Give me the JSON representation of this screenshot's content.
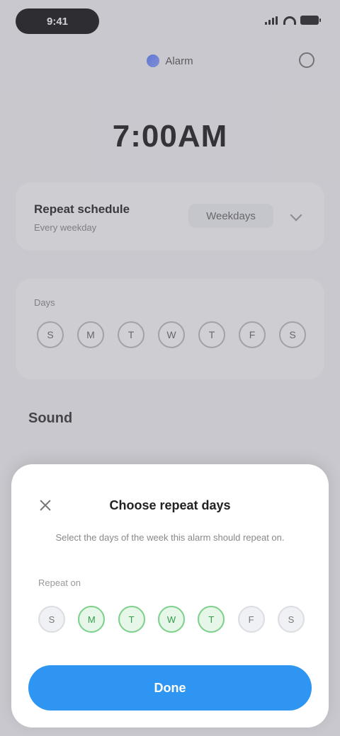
{
  "status_bar": {
    "time": "9:41"
  },
  "header": {
    "app_name": "Alarm",
    "title": "7:00AM"
  },
  "repeat_card": {
    "label": "Repeat schedule",
    "sublabel": "Every weekday",
    "value": "Weekdays"
  },
  "weekday_card": {
    "heading": "Days",
    "days": [
      "S",
      "M",
      "T",
      "W",
      "T",
      "F",
      "S"
    ]
  },
  "section": {
    "title": "Sound"
  },
  "sheet": {
    "title": "Choose repeat days",
    "description": "Select the days of the week this alarm should repeat on.",
    "label": "Repeat on",
    "days": [
      {
        "label": "S",
        "on": false
      },
      {
        "label": "M",
        "on": true
      },
      {
        "label": "T",
        "on": true
      },
      {
        "label": "W",
        "on": true
      },
      {
        "label": "T",
        "on": true
      },
      {
        "label": "F",
        "on": false
      },
      {
        "label": "S",
        "on": false
      }
    ],
    "confirm_label": "Done"
  },
  "colors": {
    "accent": "#2f95f2",
    "selected_day": "#7bd08a"
  }
}
